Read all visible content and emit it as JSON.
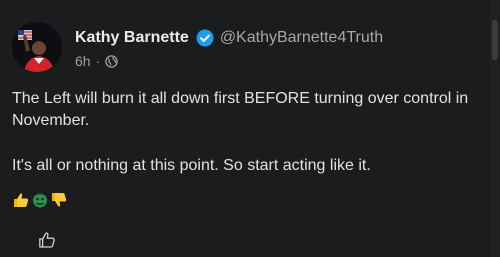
{
  "author": {
    "display_name": "Kathy Barnette",
    "handle": "@KathyBarnette4Truth",
    "verified": true
  },
  "post": {
    "timestamp": "6h",
    "separator": "·",
    "visibility_icon": "globe-icon",
    "paragraphs": [
      "The Left will burn it all down first BEFORE turning over control in November.",
      "It's all or nothing at this point. So start acting like it."
    ],
    "emojis": [
      "thumbs-up-emoji",
      "face-emoji",
      "thumbs-down-emoji"
    ]
  },
  "actions": {
    "like_icon": "thumbs-up-icon"
  },
  "colors": {
    "background": "#1b1c1e",
    "verified_blue": "#1d9bf0",
    "text_primary": "#e6e6e6",
    "text_secondary": "#a8a8a8"
  }
}
